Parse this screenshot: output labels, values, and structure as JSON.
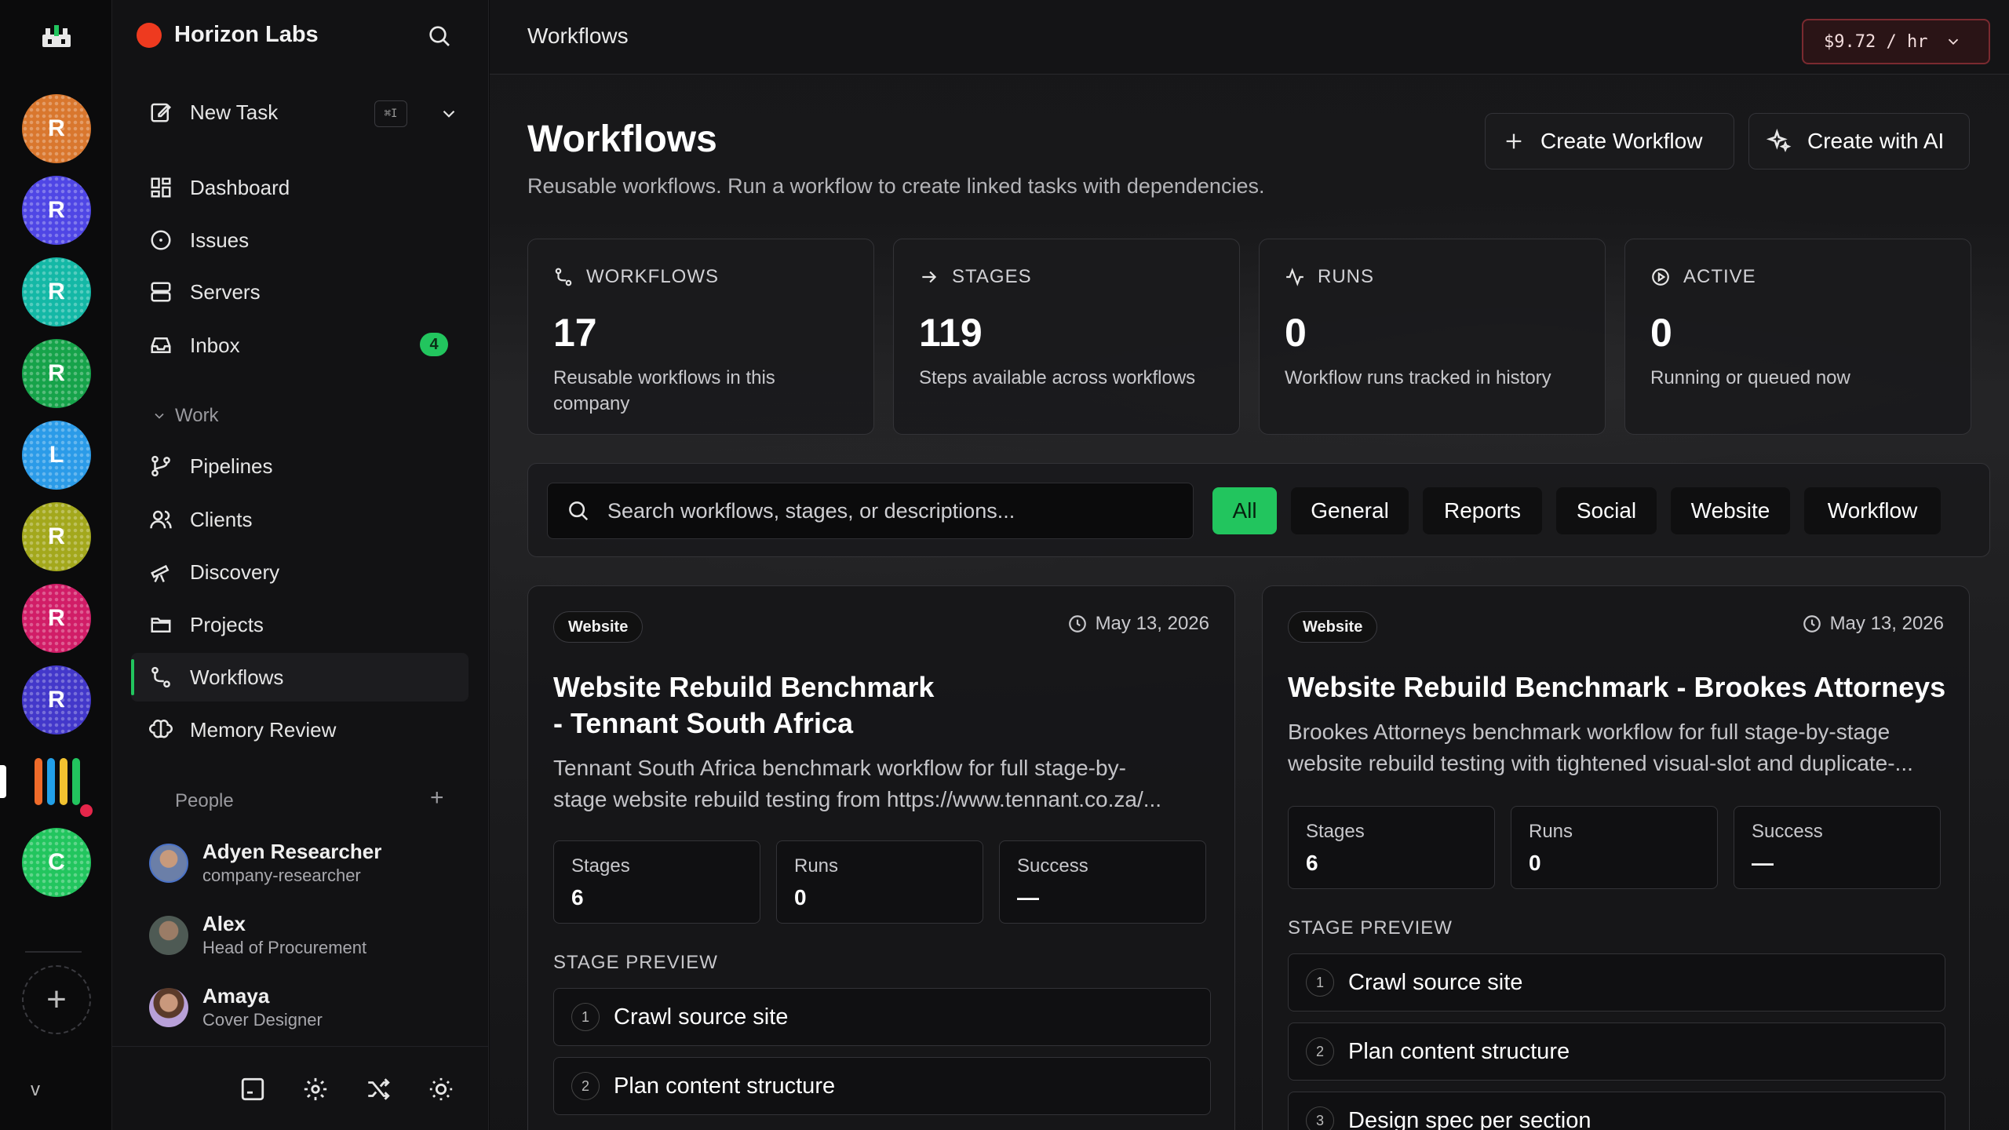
{
  "rail": {
    "avatars": [
      {
        "letter": "R",
        "color": "#d9772e"
      },
      {
        "letter": "R",
        "color": "#4f46e5"
      },
      {
        "letter": "R",
        "color": "#14b8a6"
      },
      {
        "letter": "R",
        "color": "#16a34a"
      },
      {
        "letter": "L",
        "color": "#2b9be8"
      },
      {
        "letter": "R",
        "color": "#a3a81c"
      },
      {
        "letter": "R",
        "color": "#d11d67"
      },
      {
        "letter": "R",
        "color": "#4338ca"
      },
      {
        "letter": "C",
        "color": "#22c55e"
      }
    ],
    "bar_colors": [
      "#ef6b2a",
      "#22a0e8",
      "#f2c230",
      "#22c55e"
    ]
  },
  "sidebar": {
    "company": "Horizon Labs",
    "new_task": "New Task",
    "shortcut": "⌘I",
    "nav": [
      {
        "label": "Dashboard",
        "icon": "dashboard-icon"
      },
      {
        "label": "Issues",
        "icon": "issues-icon"
      },
      {
        "label": "Servers",
        "icon": "servers-icon"
      },
      {
        "label": "Inbox",
        "icon": "inbox-icon",
        "badge": "4"
      }
    ],
    "work_section": "Work",
    "work": [
      {
        "label": "Pipelines",
        "icon": "pipelines-icon"
      },
      {
        "label": "Clients",
        "icon": "clients-icon"
      },
      {
        "label": "Discovery",
        "icon": "telescope-icon"
      },
      {
        "label": "Projects",
        "icon": "folder-icon"
      },
      {
        "label": "Workflows",
        "icon": "workflow-icon",
        "active": true
      },
      {
        "label": "Memory Review",
        "icon": "brain-icon"
      }
    ],
    "people_section": "People",
    "people": [
      {
        "name": "Adyen Researcher",
        "role": "company-researcher"
      },
      {
        "name": "Alex",
        "role": "Head of Procurement"
      },
      {
        "name": "Amaya",
        "role": "Cover Designer"
      }
    ],
    "version": "v"
  },
  "topbar": {
    "title": "Workflows",
    "cost": "$9.72 / hr"
  },
  "header": {
    "title": "Workflows",
    "subtitle": "Reusable workflows. Run a workflow to create linked tasks with dependencies.",
    "create_button": "Create Workflow",
    "ai_button": "Create with AI"
  },
  "stats": [
    {
      "label": "WORKFLOWS",
      "value": "17",
      "desc": "Reusable workflows in this company"
    },
    {
      "label": "STAGES",
      "value": "119",
      "desc": "Steps available across workflows"
    },
    {
      "label": "RUNS",
      "value": "0",
      "desc": "Workflow runs tracked in history"
    },
    {
      "label": "ACTIVE",
      "value": "0",
      "desc": "Running or queued now"
    }
  ],
  "search": {
    "placeholder": "Search workflows, stages, or descriptions..."
  },
  "filters": [
    "All",
    "General",
    "Reports",
    "Social",
    "Website",
    "Workflow"
  ],
  "cards": [
    {
      "tag": "Website",
      "date": "May 13, 2026",
      "title_lines": [
        "Website Rebuild Benchmark",
        "- Tennant South Africa"
      ],
      "desc_lines": [
        "Tennant South Africa benchmark workflow for full stage-by-",
        "stage website rebuild testing from https://www.tennant.co.za/..."
      ],
      "stages_label": "Stages",
      "stages": "6",
      "runs_label": "Runs",
      "runs": "0",
      "success_label": "Success",
      "success": "—",
      "preview_label": "STAGE PREVIEW",
      "preview": [
        {
          "n": "1",
          "name": "Crawl source site"
        },
        {
          "n": "2",
          "name": "Plan content structure"
        }
      ]
    },
    {
      "tag": "Website",
      "date": "May 13, 2026",
      "title_lines": [
        "Website Rebuild Benchmark - Brookes Attorneys"
      ],
      "desc_lines": [
        "Brookes Attorneys benchmark workflow for full stage-by-stage",
        "website rebuild testing with tightened visual-slot and duplicate-..."
      ],
      "stages_label": "Stages",
      "stages": "6",
      "runs_label": "Runs",
      "runs": "0",
      "success_label": "Success",
      "success": "—",
      "preview_label": "STAGE PREVIEW",
      "preview": [
        {
          "n": "1",
          "name": "Crawl source site"
        },
        {
          "n": "2",
          "name": "Plan content structure"
        },
        {
          "n": "3",
          "name": "Design spec per section"
        }
      ]
    }
  ]
}
